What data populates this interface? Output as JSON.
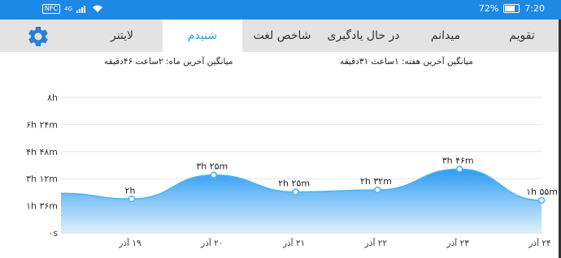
{
  "status_bar": {
    "left_icons": [
      "nfc-icon",
      "sim-4g-icon",
      "signal-icon",
      "wifi-icon"
    ],
    "nfc_label": "NFC",
    "network": "4G",
    "battery": "72%",
    "battery_level": 0.72,
    "time": "7:20"
  },
  "tabs": [
    {
      "label": "تقویم",
      "active": false
    },
    {
      "label": "میدانم",
      "active": false
    },
    {
      "label": "در حال یادگیری",
      "active": false
    },
    {
      "label": "شاخص لغت",
      "active": false
    },
    {
      "label": "شنیدم",
      "active": true
    },
    {
      "label": "لایتنر",
      "active": false
    }
  ],
  "settings_icon": "gear-icon",
  "averages": {
    "week": "میانگین آخرین هفته: ۱ساعت ۳۱دقیقه",
    "month": "میانگین آخرین ماه: ۲ساعت ۴۶دقیقه"
  },
  "colors": {
    "status_bar": "#1e88e5",
    "tab_bar": "#e3e3e3",
    "active_tab_text": "#29a0d8",
    "gear": "#2a7fd4",
    "series_line": "#4fb2ef"
  },
  "chart_data": {
    "type": "area",
    "title": "",
    "xlabel": "",
    "ylabel": "",
    "categories": [
      "۱۹ آذر",
      "۲۰ آذر",
      "۲۱ آذر",
      "۲۲ آذر",
      "۲۳ آذر",
      "۲۴ آذر"
    ],
    "y_tick_labels": [
      "0s",
      "1h 36m",
      "3h 12m",
      "4h 48m",
      "6h 24m",
      "8h"
    ],
    "y_tick_display": [
      "۰s",
      "۱h ۳۶m",
      "۳h ۱۲m",
      "۴h ۴۸m",
      "۶h ۲۴m",
      "۸h"
    ],
    "ylim_minutes": [
      0,
      480
    ],
    "grid": true,
    "series": [
      {
        "values_minutes": [
          120,
          205,
          145,
          152,
          226,
          115
        ],
        "data_labels": [
          "۲h",
          "۳h ۲۵m",
          "۲h ۲۵m",
          "۲h ۳۲m",
          "۳h ۴۶m",
          "۱h ۵۵m"
        ]
      }
    ]
  }
}
